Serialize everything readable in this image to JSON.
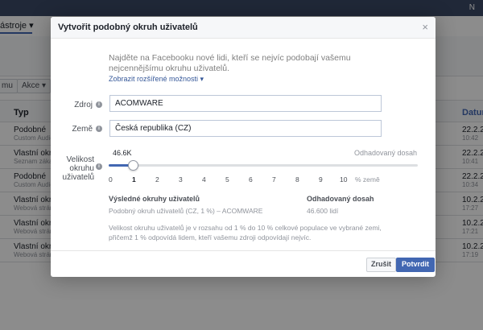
{
  "background": {
    "topbar_right": "N",
    "tools_label": "ástroje ▾",
    "btn_partial": "mu",
    "actions_label": "Akce ▾",
    "col_type": "Typ",
    "col_date": "Datum",
    "rows": [
      {
        "type": "Podobné",
        "sub": "Custom Audie",
        "date": "22.2.20",
        "time": "10:42"
      },
      {
        "type": "Vlastní okruh",
        "sub": "Seznam zákaz",
        "date": "22.2.20",
        "time": "10:41"
      },
      {
        "type": "Podobné",
        "sub": "Custom Audie",
        "date": "22.2.20",
        "time": "10:34"
      },
      {
        "type": "Vlastní okruh",
        "sub": "Webová strán",
        "date": "10.2.20",
        "time": "17:27"
      },
      {
        "type": "Vlastní okruh",
        "sub": "Webová strán",
        "date": "10.2.20",
        "time": "17:21"
      },
      {
        "type": "Vlastní okruh",
        "sub": "Webová strán",
        "date": "10.2.20",
        "time": "17:19"
      }
    ]
  },
  "modal": {
    "title": "Vytvořit podobný okruh uživatelů",
    "close": "×",
    "intro": "Najděte na Facebooku nové lidi, kteří se nejvíc podobají vašemu nejcennějšímu okruhu uživatelů.",
    "advanced_link": "Zobrazit rozšířené možnosti ▾",
    "source_label": "Zdroj",
    "source_value": "ACOMWARE",
    "country_label": "Země",
    "country_value": "Česká republika (CZ)",
    "size_label": "Velikost okruhu uživatelů",
    "slider_value_label": "46.6K",
    "slider_percent": 1,
    "estimated_label": "Odhadovaný dosah",
    "ticks": [
      "0",
      "1",
      "2",
      "3",
      "4",
      "5",
      "6",
      "7",
      "8",
      "9",
      "10"
    ],
    "percent_of_country": "% země",
    "results_header": "Výsledné okruhy uživatelů",
    "reach_header": "Odhadovaný dosah",
    "result_name": "Podobný okruh uživatelů (CZ, 1 %) – ACOMWARE",
    "result_reach": "46.600 lidí",
    "note": "Velikost okruhu uživatelů je v rozsahu od 1 % do 10 % celkové populace ve vybrané zemi, přičemž 1 % odpovídá lidem, kteří vašemu zdroji odpovídají nejvíc.",
    "cancel_label": "Zrušit",
    "confirm_label": "Potvrdit"
  },
  "colors": {
    "primary": "#4267b2",
    "link": "#365899",
    "topbar": "#3b4a66"
  }
}
